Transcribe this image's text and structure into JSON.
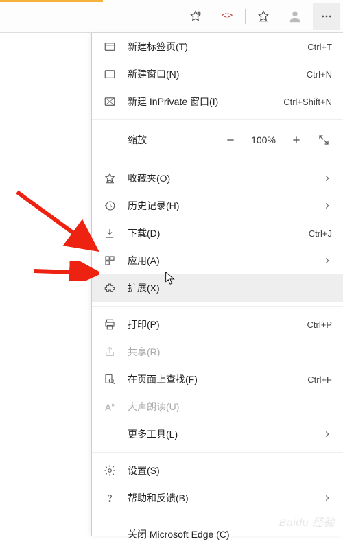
{
  "zoom": {
    "label": "缩放",
    "value": "100%"
  },
  "menu": [
    {
      "label": "新建标签页(T)",
      "shortcut": "Ctrl+T"
    },
    {
      "label": "新建窗口(N)",
      "shortcut": "Ctrl+N"
    },
    {
      "label": "新建 InPrivate 窗口(I)",
      "shortcut": "Ctrl+Shift+N"
    }
  ],
  "favorites": {
    "label": "收藏夹(O)"
  },
  "history": {
    "label": "历史记录(H)"
  },
  "downloads": {
    "label": "下载(D)",
    "shortcut": "Ctrl+J"
  },
  "apps": {
    "label": "应用(A)"
  },
  "extensions": {
    "label": "扩展(X)"
  },
  "print": {
    "label": "打印(P)",
    "shortcut": "Ctrl+P"
  },
  "share": {
    "label": "共享(R)"
  },
  "find": {
    "label": "在页面上查找(F)",
    "shortcut": "Ctrl+F"
  },
  "readaloud": {
    "label": "大声朗读(U)"
  },
  "moretools": {
    "label": "更多工具(L)"
  },
  "settings": {
    "label": "设置(S)"
  },
  "help": {
    "label": "帮助和反馈(B)"
  },
  "close": {
    "label": "关闭 Microsoft Edge (C)"
  },
  "watermark": "Baidu 经验"
}
